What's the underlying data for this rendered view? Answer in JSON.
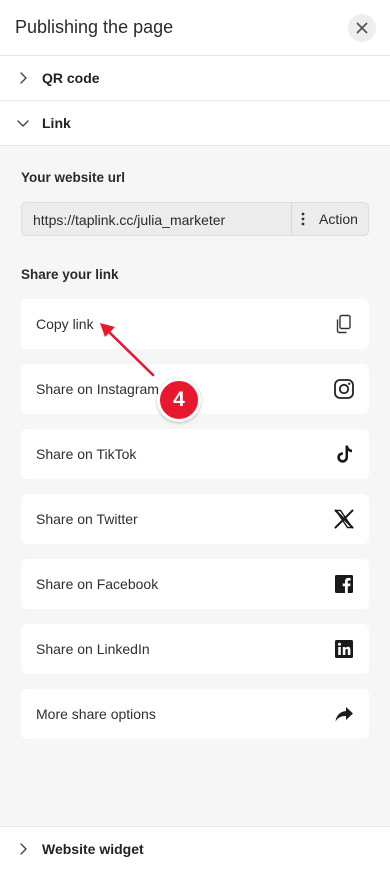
{
  "header": {
    "title": "Publishing the page",
    "close_icon": "close-icon"
  },
  "accordion": {
    "qr_code": "QR code",
    "link": "Link",
    "website_widget": "Website widget"
  },
  "link_panel": {
    "url_label": "Your website url",
    "url_value": "https://taplink.cc/julia_marketer",
    "action_label": "Action",
    "share_label": "Share your link",
    "share_items": [
      {
        "label": "Copy link",
        "icon": "copy-icon"
      },
      {
        "label": "Share on Instagram",
        "icon": "instagram-icon"
      },
      {
        "label": "Share on TikTok",
        "icon": "tiktok-icon"
      },
      {
        "label": "Share on Twitter",
        "icon": "x-twitter-icon"
      },
      {
        "label": "Share on Facebook",
        "icon": "facebook-icon"
      },
      {
        "label": "Share on LinkedIn",
        "icon": "linkedin-icon"
      },
      {
        "label": "More share options",
        "icon": "share-arrow-icon"
      }
    ]
  },
  "annotation": {
    "badge_number": "4",
    "badge_color": "#e8192c"
  }
}
